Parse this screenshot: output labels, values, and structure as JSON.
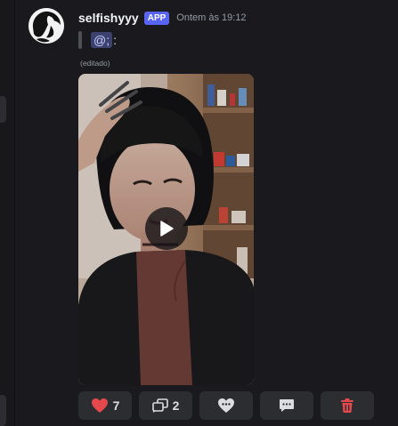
{
  "message": {
    "username": "selfishyyy",
    "badge": "APP",
    "timestamp": "Ontem às 19:12",
    "quote": {
      "mention": "@;",
      "after_mention": ":"
    },
    "edited_label": "(editado)"
  },
  "media": {
    "type": "video"
  },
  "actions": {
    "like": {
      "icon": "heart-icon",
      "count": "7"
    },
    "repost": {
      "icon": "repost-icon",
      "count": "2"
    },
    "add_reaction": {
      "icon": "heart-chat-icon"
    },
    "comment": {
      "icon": "chat-icon"
    },
    "delete": {
      "icon": "trash-icon"
    }
  },
  "colors": {
    "background": "#1a1a1e",
    "badge": "#5865f2",
    "button_bg": "#2b2d31",
    "heart": "#e5484d",
    "trash": "#e5484d"
  }
}
